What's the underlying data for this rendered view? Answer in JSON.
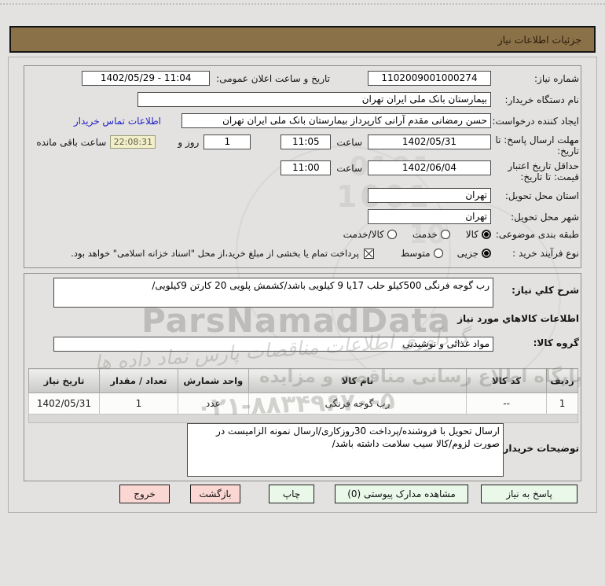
{
  "title_bar": {
    "title": "جزئیات اطلاعات نیاز"
  },
  "form": {
    "need_number": {
      "label": "شماره نیاز:",
      "value": "1102009001000274"
    },
    "announce_datetime": {
      "label": "تاریخ و ساعت اعلان عمومی:",
      "value": "1402/05/29 - 11:04"
    },
    "buyer_org": {
      "label": "نام دستگاه خریدار:",
      "value": "بیمارستان بانک ملی ایران تهران"
    },
    "request_creator": {
      "label": "ایجاد کننده درخواست:",
      "value": "حسن رمضانی مقدم آرانی کارپرداز بیمارستان بانک ملی ایران تهران",
      "contact_link": "اطلاعات تماس خریدار"
    },
    "reply_deadline": {
      "label": "مهلت ارسال پاسخ: تا تاریخ:",
      "date": "1402/05/31",
      "hour_label": "ساعت",
      "time": "11:05",
      "days_value": "1",
      "days_label": "روز و",
      "countdown": "22:08:31",
      "remaining_label": "ساعت باقی مانده"
    },
    "price_validity": {
      "label": "حداقل تاریخ اعتبار قیمت: تا تاریخ:",
      "date": "1402/06/04",
      "hour_label": "ساعت",
      "time": "11:00"
    },
    "delivery_province": {
      "label": "استان محل تحویل:",
      "value": "تهران"
    },
    "delivery_city": {
      "label": "شهر محل تحویل:",
      "value": "تهران"
    },
    "subject_class": {
      "label": "طبقه بندی موضوعی:",
      "options": [
        {
          "label": "کالا",
          "selected": true
        },
        {
          "label": "خدمت",
          "selected": false
        },
        {
          "label": "کالا/خدمت",
          "selected": false
        }
      ]
    },
    "purchase_type": {
      "label": "نوع فرآیند خرید :",
      "options": [
        {
          "label": "جزیی",
          "selected": true
        },
        {
          "label": "متوسط",
          "selected": false
        }
      ],
      "checkbox_label": "پرداخت تمام یا بخشی از مبلغ خرید،از محل \"اسناد خزانه اسلامی\" خواهد بود.",
      "checkbox_checked": true
    }
  },
  "need_section": {
    "desc_label": "شرح کلي نیاز:",
    "desc_value": "رب گوجه فرنگی 500کیلو حلب 17یا 9 کیلویی باشد/کشمش پلویی 20 کارتن 9کیلویی/",
    "goods_header": "اطلاعات کالاهاي مورد نیاز",
    "group_label": "گروه کالا:",
    "group_value": "مواد غذائی و نوشیدنی",
    "table": {
      "headers": [
        "ردیف",
        "کد کالا",
        "نام کالا",
        "واحد شمارش",
        "تعداد / مقدار",
        "تاریخ نیاز"
      ],
      "rows": [
        [
          "1",
          "--",
          "رب گوجه فرنگی",
          "عدد",
          "1",
          "1402/05/31"
        ]
      ]
    },
    "buyer_notes_label": "توضیحات خریدار:",
    "buyer_notes_value": "ارسال تحویل با فروشنده/پرداخت 30روزکاری/ارسال نمونه الزامیست در صورت لزوم/کالا سیب سلامت داشته باشد/"
  },
  "actions": {
    "reply": "پاسخ به نیاز",
    "docs": "مشاهده مدارک پیوستی (0)",
    "print": "چاپ",
    "back": "بازگشت",
    "exit": "خروج"
  },
  "watermark": {
    "brand": "ParsNamadData",
    "script_line": "گردآوری اطلاعات مناقصات پارس نماد داده ها",
    "portal_line": "پایگاه اطلاع رسانی مناقصه و مزایده",
    "phone": "۰۲۱-۸۸۳۴۹۶۷۰-۵",
    "digits_a": "0101",
    "digits_b": "1001",
    "digits_c": "10"
  },
  "colors": {
    "title_bar_bg": "#8a7148",
    "page_bg": "#e3e2e0",
    "countdown_bg": "#f1eec9",
    "button_green": "#e9f8e9",
    "button_pink": "#fbd7d3",
    "link_blue": "#2323c8"
  }
}
